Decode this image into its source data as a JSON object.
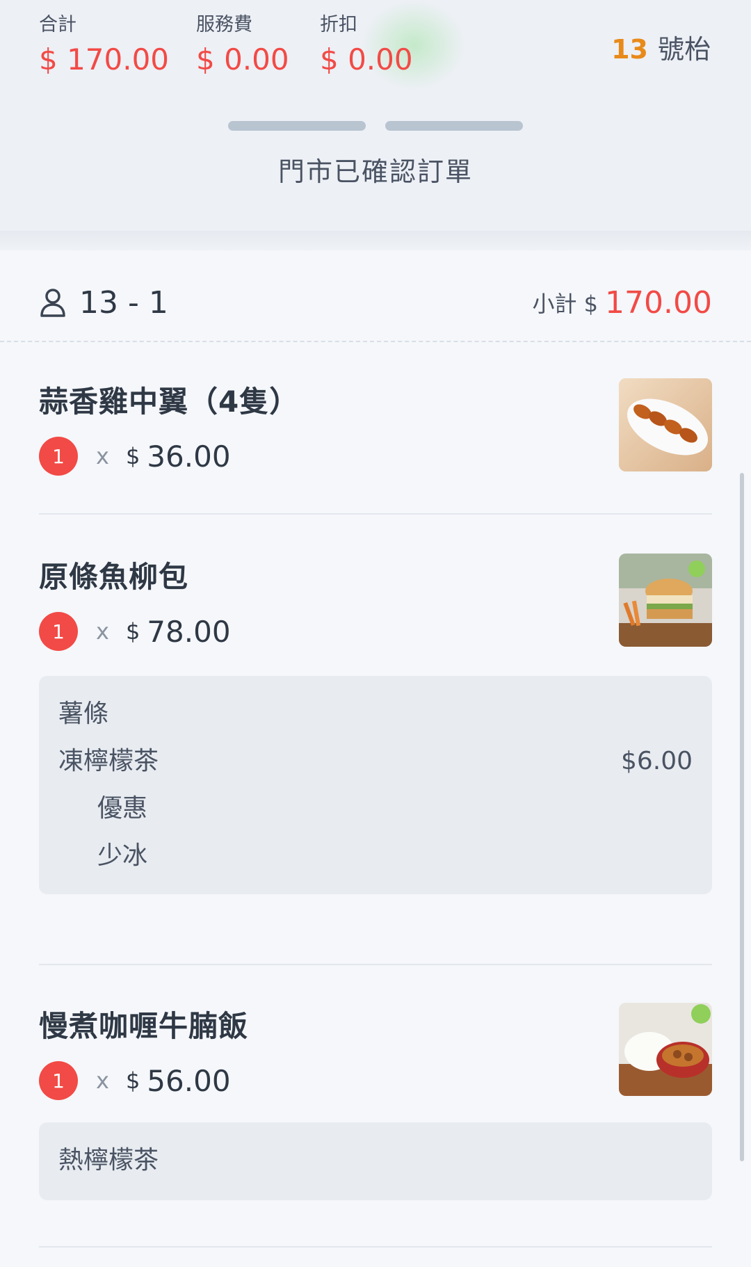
{
  "summary": {
    "total_label": "合計",
    "total_value": "$ 170.00",
    "service_label": "服務費",
    "service_value": "$ 0.00",
    "discount_label": "折扣",
    "discount_value": "$ 0.00"
  },
  "table": {
    "number": "13",
    "suffix": "號枱"
  },
  "status": {
    "text": "門市已確認訂單"
  },
  "order": {
    "guest_id": "13 - 1",
    "subtotal_label": "小計 $",
    "subtotal_value": "170.00"
  },
  "items": [
    {
      "name": "蒜香雞中翼（4隻）",
      "qty": "1",
      "times": "x",
      "currency": "$",
      "price": "36.00"
    },
    {
      "name": "原條魚柳包",
      "qty": "1",
      "times": "x",
      "currency": "$",
      "price": "78.00",
      "options": {
        "side": "薯條",
        "drink": "凍檸檬茶",
        "drink_price": "$6.00",
        "mod1": "優惠",
        "mod2": "少冰"
      }
    },
    {
      "name": "慢煮咖喱牛腩飯",
      "qty": "1",
      "times": "x",
      "currency": "$",
      "price": "56.00",
      "options": {
        "drink": "熱檸檬茶"
      }
    }
  ],
  "colors": {
    "accent_red": "#f24a46",
    "table_orange": "#e88a1a",
    "progress_gray": "#b9c4d1"
  },
  "icons": {
    "guest": "user-icon"
  }
}
